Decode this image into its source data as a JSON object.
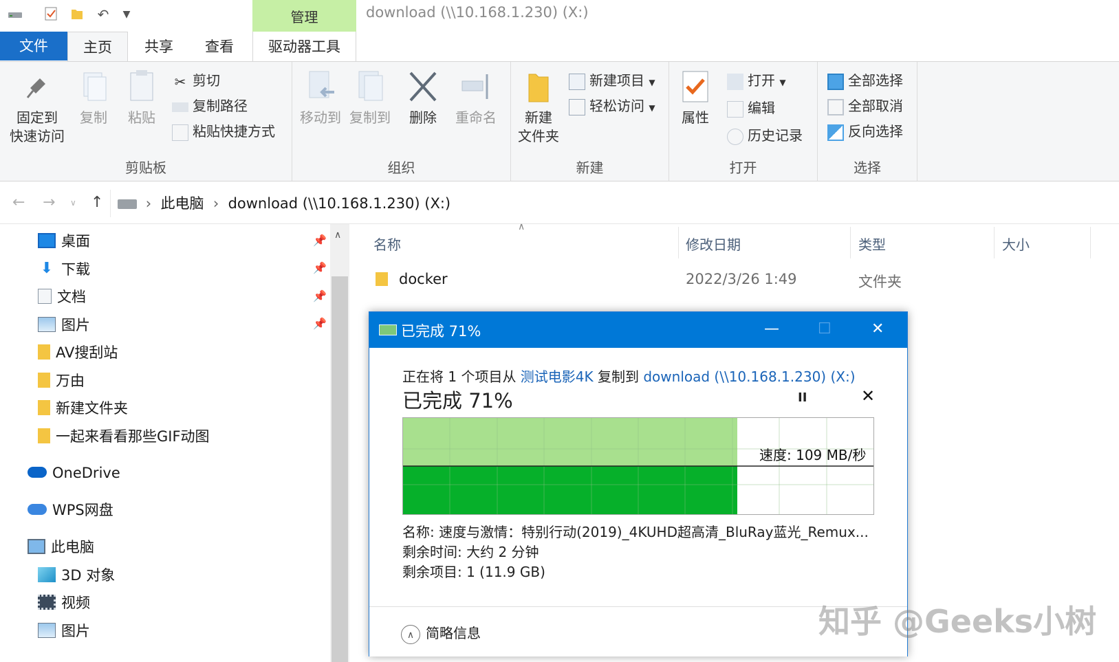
{
  "window": {
    "title": "download (\\\\10.168.1.230) (X:)"
  },
  "ribbon_tabs": {
    "file": "文件",
    "home": "主页",
    "share": "共享",
    "view": "查看",
    "manage_context": "管理",
    "drive_tools": "驱动器工具"
  },
  "ribbon": {
    "clipboard": {
      "label": "剪贴板",
      "pin_line1": "固定到",
      "pin_line2": "快速访问",
      "copy": "复制",
      "paste": "粘贴",
      "cut": "剪切",
      "copy_path": "复制路径",
      "paste_shortcut": "粘贴快捷方式"
    },
    "organize": {
      "label": "组织",
      "move_to": "移动到",
      "copy_to": "复制到",
      "delete": "删除",
      "rename": "重命名"
    },
    "new": {
      "label": "新建",
      "new_folder_line1": "新建",
      "new_folder_line2": "文件夹",
      "new_item": "新建项目",
      "easy_access": "轻松访问"
    },
    "open": {
      "label": "打开",
      "properties": "属性",
      "open": "打开",
      "edit": "编辑",
      "history": "历史记录"
    },
    "select": {
      "label": "选择",
      "select_all": "全部选择",
      "select_none": "全部取消",
      "invert": "反向选择"
    }
  },
  "address": {
    "this_pc": "此电脑",
    "location": "download (\\\\10.168.1.230) (X:)"
  },
  "nav": {
    "quick": [
      "桌面",
      "下载",
      "文档",
      "图片",
      "AV搜刮站",
      "万由",
      "新建文件夹",
      "一起来看看那些GIF动图"
    ],
    "onedrive": "OneDrive",
    "wps": "WPS网盘",
    "this_pc": "此电脑",
    "pc_items": [
      "3D 对象",
      "视频",
      "图片"
    ]
  },
  "columns": {
    "name": "名称",
    "modified": "修改日期",
    "type": "类型",
    "size": "大小"
  },
  "files": [
    {
      "name": "docker",
      "modified": "2022/3/26 1:49",
      "type": "文件夹",
      "size": ""
    }
  ],
  "dialog": {
    "title": "已完成 71%",
    "copy_prefix": "正在将 1 个项目从 ",
    "source": "测试电影4K",
    "copy_mid": " 复制到 ",
    "dest": "download (\\\\10.168.1.230) (X:)",
    "percent_text": "已完成 71%",
    "progress": 0.71,
    "speed": "速度: 109 MB/秒",
    "name_line": "名称:  速度与激情：特别行动(2019)_4KUHD超高清_BluRay蓝光_Remux...",
    "time_line": "剩余时间:  大约 2 分钟",
    "items_line": "剩余项目:  1 (11.9 GB)",
    "less_info": "简略信息",
    "colors": {
      "titlebar": "#0078d7",
      "fill_light": "#a8e08e",
      "fill_dark": "#06b02a"
    }
  },
  "watermark": "知乎 @Geeks小树"
}
